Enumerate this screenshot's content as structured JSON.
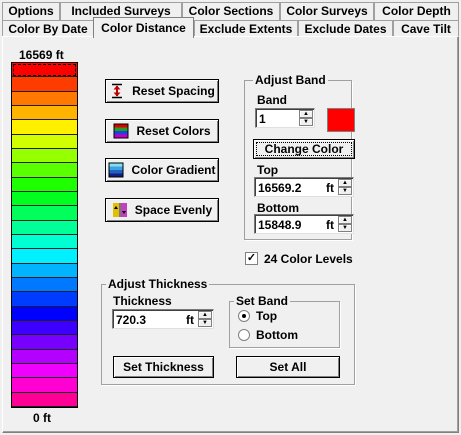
{
  "tabs_row1": [
    "Options",
    "Included Surveys",
    "Color Sections",
    "Color Surveys",
    "Color Depth"
  ],
  "tabs_row2": [
    "Color By Date",
    "Color Distance",
    "Exclude Extents",
    "Exclude Dates",
    "Cave Tilt"
  ],
  "active_tab": "Color Distance",
  "scale": {
    "top_label": "16569 ft",
    "bottom_label": "0 ft"
  },
  "bands": [
    "#ff0000",
    "#ff3c00",
    "#ff7800",
    "#ffb400",
    "#fff000",
    "#d2ff00",
    "#96ff00",
    "#5aff00",
    "#1eff00",
    "#00ff1e",
    "#00ff5a",
    "#00ff96",
    "#00ffd2",
    "#00f0ff",
    "#00b4ff",
    "#0078ff",
    "#003cff",
    "#0000ff",
    "#3c00ff",
    "#7800ff",
    "#b400ff",
    "#f000ff",
    "#ff00d2",
    "#ff0096"
  ],
  "buttons": {
    "reset_spacing": "Reset Spacing",
    "reset_colors": "Reset Colors",
    "color_gradient": "Color Gradient",
    "space_evenly": "Space Evenly",
    "change_color": "Change Color",
    "set_thickness": "Set Thickness",
    "set_all": "Set All"
  },
  "adjust_band": {
    "title": "Adjust Band",
    "band_label": "Band",
    "band_value": "1",
    "swatch_color": "#ff0000",
    "top_label": "Top",
    "top_value": "16569.2",
    "bottom_label": "Bottom",
    "bottom_value": "15848.9",
    "unit": "ft"
  },
  "color_levels": {
    "label": "24 Color Levels",
    "checked": true
  },
  "adjust_thickness": {
    "title": "Adjust Thickness",
    "thickness_label": "Thickness",
    "thickness_value": "720.3",
    "unit": "ft",
    "set_band_title": "Set Band",
    "option_top": "Top",
    "option_bottom": "Bottom",
    "selected": "Top"
  }
}
